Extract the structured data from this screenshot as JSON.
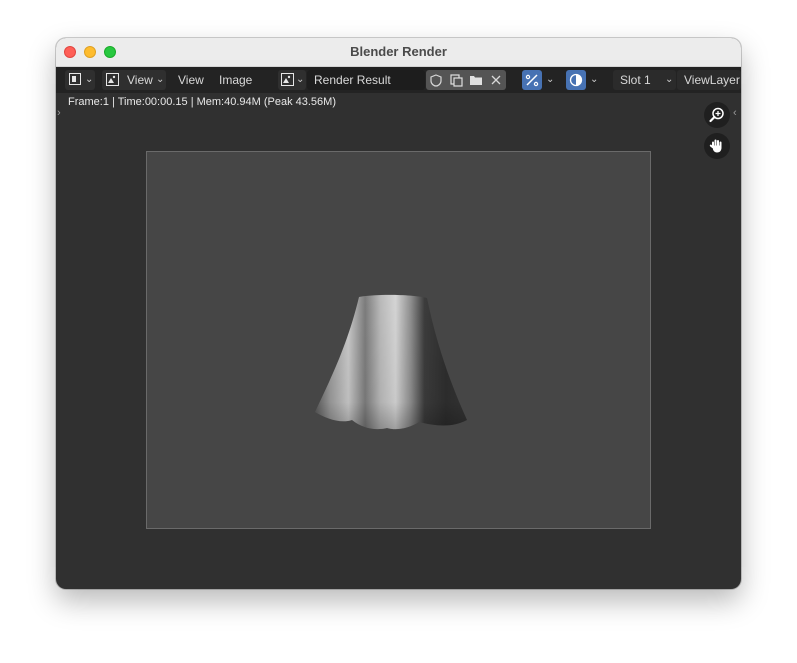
{
  "window": {
    "title": "Blender Render"
  },
  "header": {
    "editor_type_icon": "image-editor-icon",
    "view_menu_label": "View",
    "menu_view": "View",
    "menu_image": "Image",
    "image_name": "Render Result",
    "slot": "Slot 1",
    "layer": "ViewLayer"
  },
  "info": {
    "stats": "Frame:1 | Time:00:00.15 | Mem:40.94M (Peak 43.56M)"
  },
  "icons": {
    "shield": "fake-user-icon",
    "duplicate": "duplicate-icon",
    "open": "folder-icon",
    "close": "close-icon",
    "zoom": "zoom-icon",
    "pan": "hand-icon"
  },
  "colors": {
    "header_bg": "#232323",
    "canvas_bg": "#464646",
    "accent_blue": "#4772b3"
  }
}
